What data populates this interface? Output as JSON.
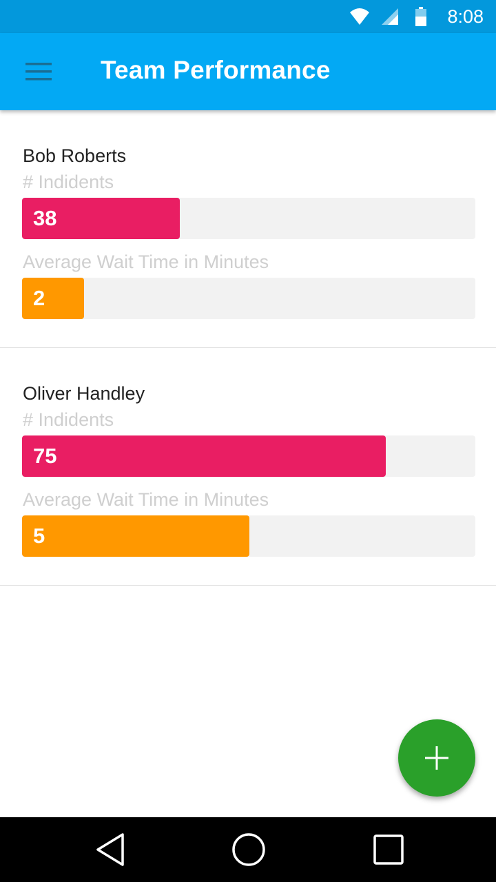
{
  "status_bar": {
    "time": "8:08",
    "icons": [
      "wifi-icon",
      "cell-signal-icon",
      "battery-icon"
    ]
  },
  "app_bar": {
    "title": "Team Performance",
    "menu_icon": "hamburger-menu-icon",
    "color": "#03a9f4"
  },
  "members": [
    {
      "name": "Bob Roberts",
      "incidents_label": "# Indidents",
      "incidents_value": "38",
      "incidents_fraction": 0.348,
      "wait_label": "Average Wait Time in Minutes",
      "wait_value": "2",
      "wait_fraction": 0.137
    },
    {
      "name": "Oliver Handley",
      "incidents_label": "# Indidents",
      "incidents_value": "75",
      "incidents_fraction": 0.802,
      "wait_label": "Average Wait Time in Minutes",
      "wait_value": "5",
      "wait_fraction": 0.502
    }
  ],
  "colors": {
    "incidents_bar": "#e91e63",
    "wait_bar": "#ff9800",
    "fab": "#2aa02a"
  },
  "fab": {
    "icon": "plus-icon"
  },
  "nav_bar": {
    "icons": [
      "back-icon",
      "home-icon",
      "recents-icon"
    ]
  }
}
